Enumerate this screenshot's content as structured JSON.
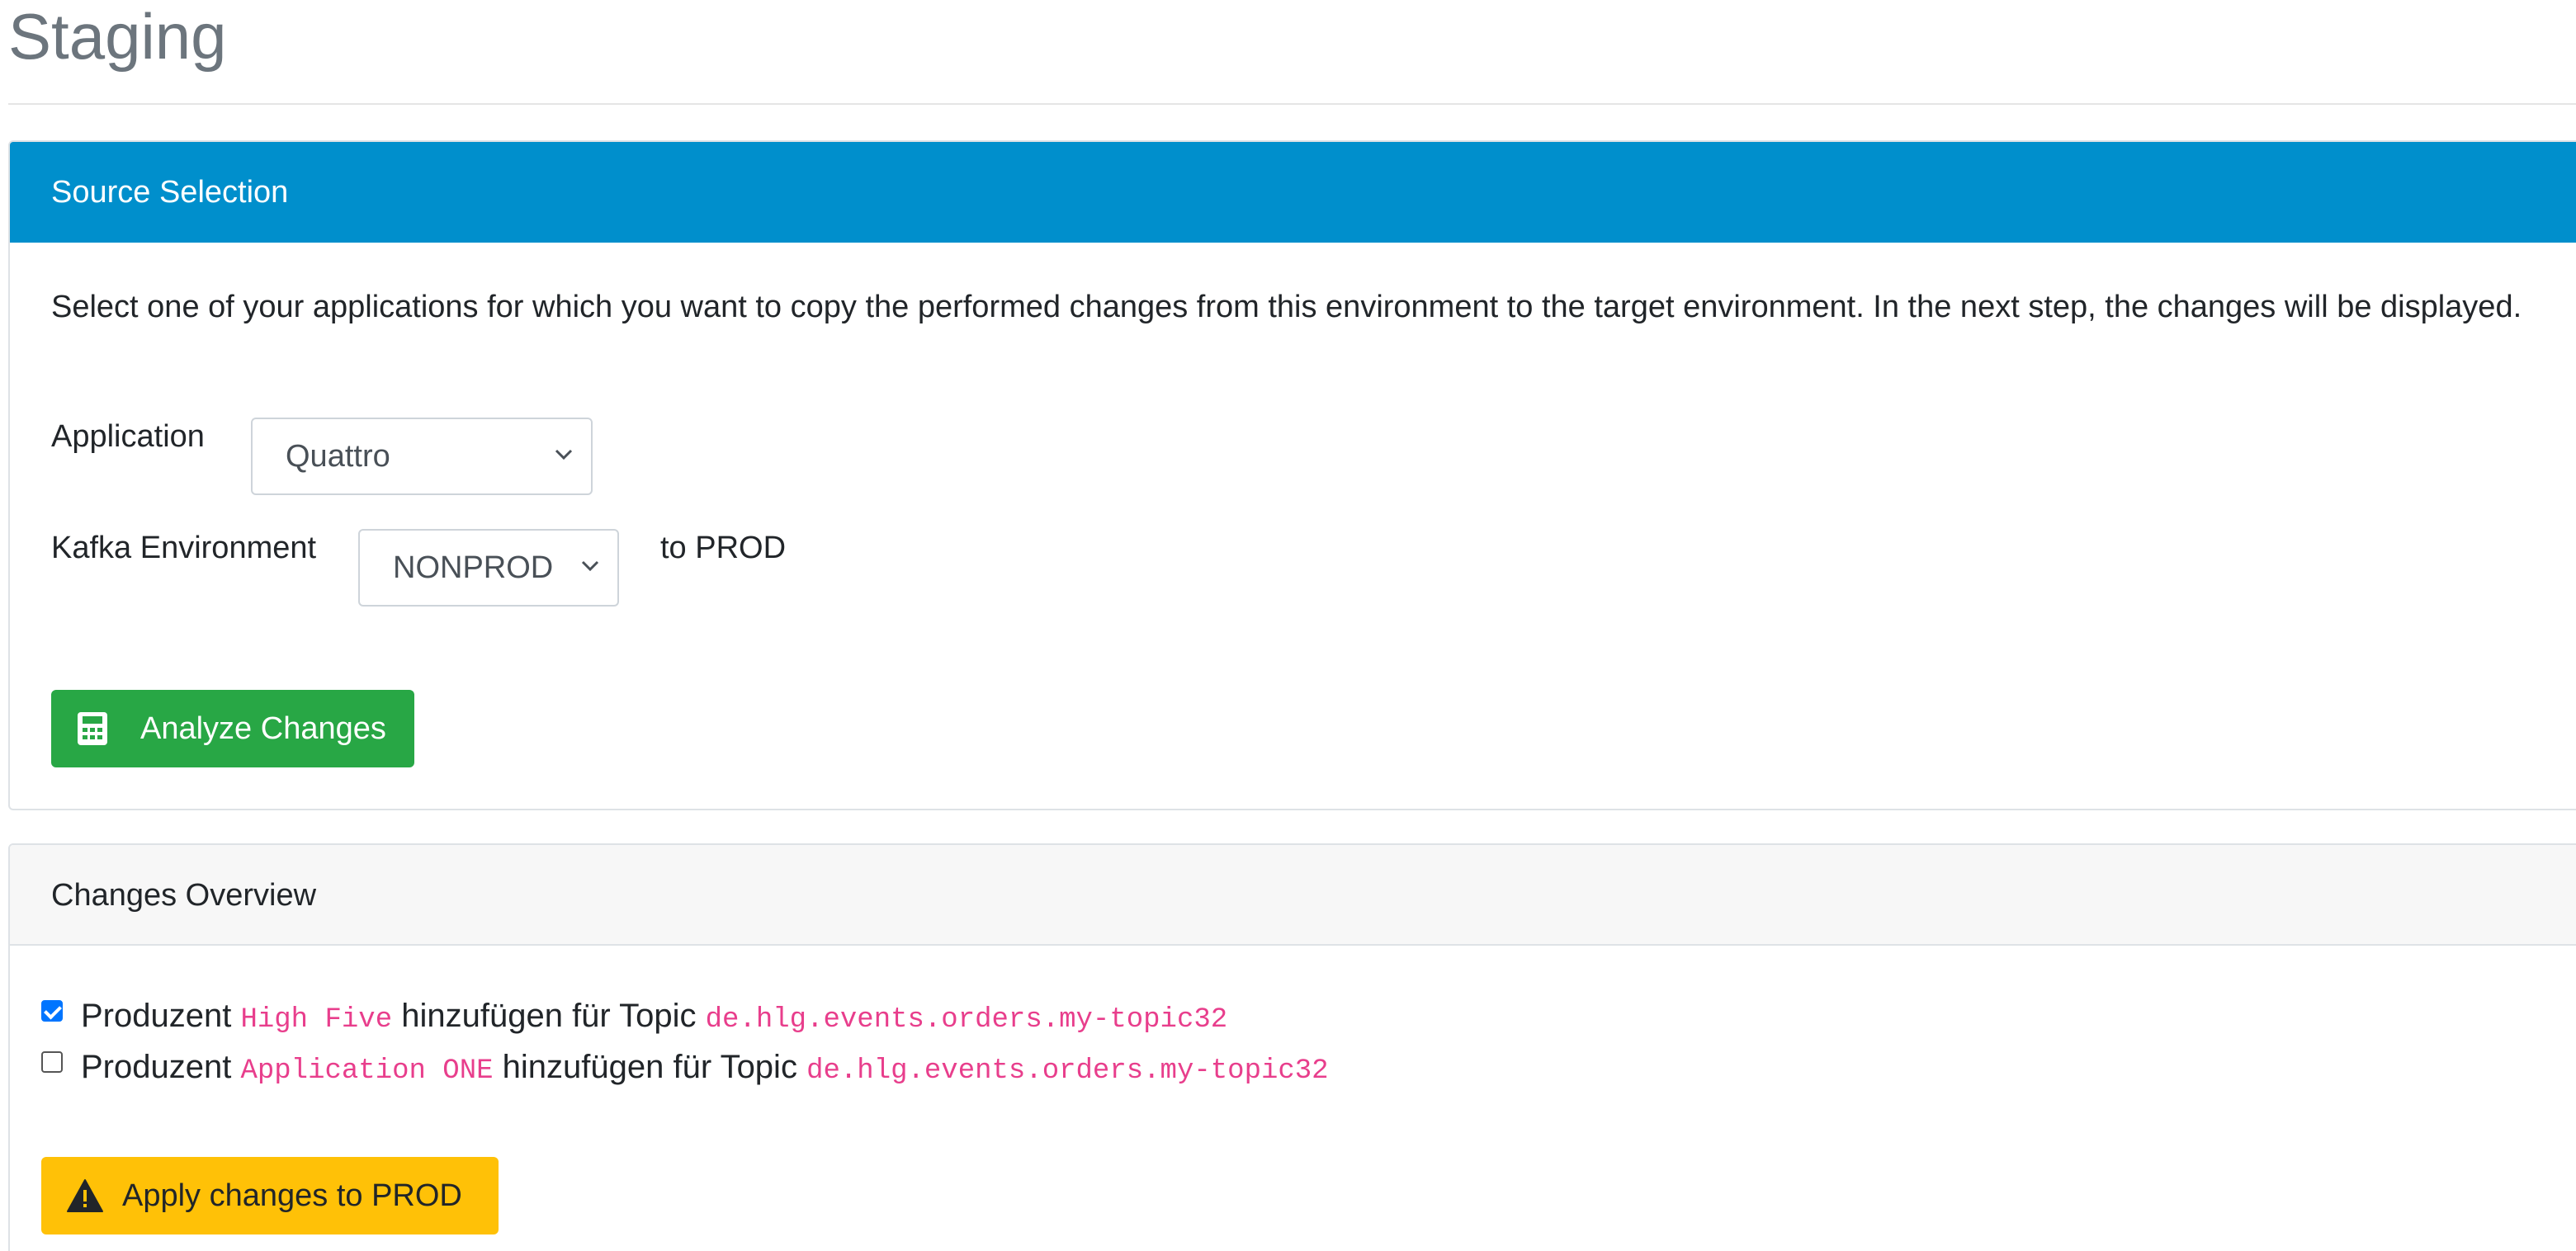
{
  "page": {
    "title": "Staging"
  },
  "source_selection": {
    "header": "Source Selection",
    "description": "Select one of your applications for which you want to copy the performed changes from this environment to the target environment. In the next step, the changes will be displayed.",
    "application_label": "Application",
    "application_value": "Quattro",
    "environment_label": "Kafka Environment",
    "environment_value": "NONPROD",
    "target_text": "to PROD",
    "analyze_button": "Analyze Changes",
    "analyze_icon": "calculator-icon",
    "header_color": "#008fcc",
    "analyze_color": "#28a745"
  },
  "changes_overview": {
    "header": "Changes Overview",
    "items": [
      {
        "checked": true,
        "prefix": "Produzent",
        "application": "High Five",
        "middle": "hinzufügen für Topic",
        "topic": "de.hlg.events.orders.my-topic32"
      },
      {
        "checked": false,
        "prefix": "Produzent",
        "application": "Application ONE",
        "middle": "hinzufügen für Topic",
        "topic": "de.hlg.events.orders.my-topic32"
      }
    ],
    "apply_button": "Apply changes to PROD",
    "apply_icon": "warning-triangle-icon",
    "apply_color": "#ffc107",
    "code_color": "#e83e8c"
  }
}
